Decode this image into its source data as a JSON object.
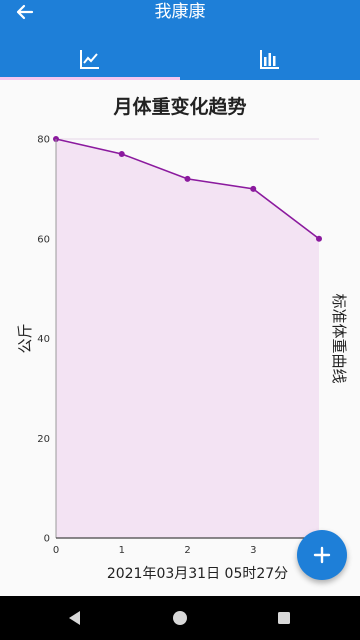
{
  "app": {
    "title": "我康康"
  },
  "tabs": [
    {
      "icon": "line-chart-icon",
      "selected": true
    },
    {
      "icon": "bar-chart-icon",
      "selected": false
    }
  ],
  "colors": {
    "primary": "#1e7fd8",
    "series_line": "#8b1a9e",
    "series_fill": "#f3e3f3",
    "tab_indicator": "#f4c6f0"
  },
  "chart_data": {
    "type": "line",
    "title": "月体重变化趋势",
    "x": [
      0,
      1,
      2,
      3,
      4
    ],
    "x_tick_labels": [
      "0",
      "1",
      "2",
      "3"
    ],
    "series": [
      {
        "name": "标准体重曲线",
        "values": [
          80,
          77,
          72,
          70,
          60
        ]
      }
    ],
    "ylabel": "公斤",
    "xlabel": "2021年03月31日 05时27分",
    "ylim": [
      0,
      80
    ],
    "xlim": [
      0,
      4
    ],
    "y_ticks": [
      0,
      20,
      40,
      60,
      80
    ],
    "grid": true,
    "filled_area": true
  },
  "fab": {
    "icon": "plus-icon"
  },
  "navbar": {
    "icons": [
      "back-triangle-icon",
      "home-circle-icon",
      "recents-square-icon"
    ]
  }
}
